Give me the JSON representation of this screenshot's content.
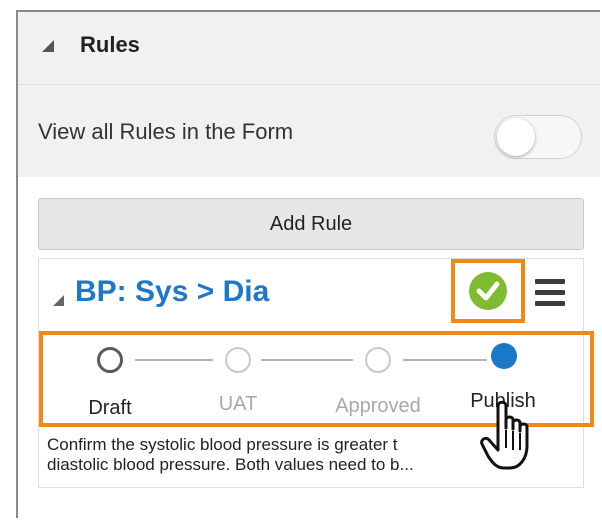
{
  "header": {
    "title": "Rules"
  },
  "toggle": {
    "label": "View all Rules in the Form"
  },
  "add_rule": {
    "label": "Add Rule"
  },
  "rule": {
    "title": "BP: Sys > Dia",
    "description_line1": "Confirm the systolic blood pressure is greater t",
    "description_line2": "diastolic blood pressure. Both values need to b..."
  },
  "steps": [
    {
      "label": "Draft"
    },
    {
      "label": "UAT"
    },
    {
      "label": "Approved"
    },
    {
      "label": "Publish"
    }
  ],
  "colors": {
    "accent": "#1f77c9",
    "highlight": "#f08a14",
    "check": "#7fbb2f",
    "step_active": "#1a78c8"
  },
  "icons": [
    "collapse-triangle-icon",
    "check-circle-icon",
    "hamburger-menu-icon",
    "hand-pointer-icon"
  ]
}
